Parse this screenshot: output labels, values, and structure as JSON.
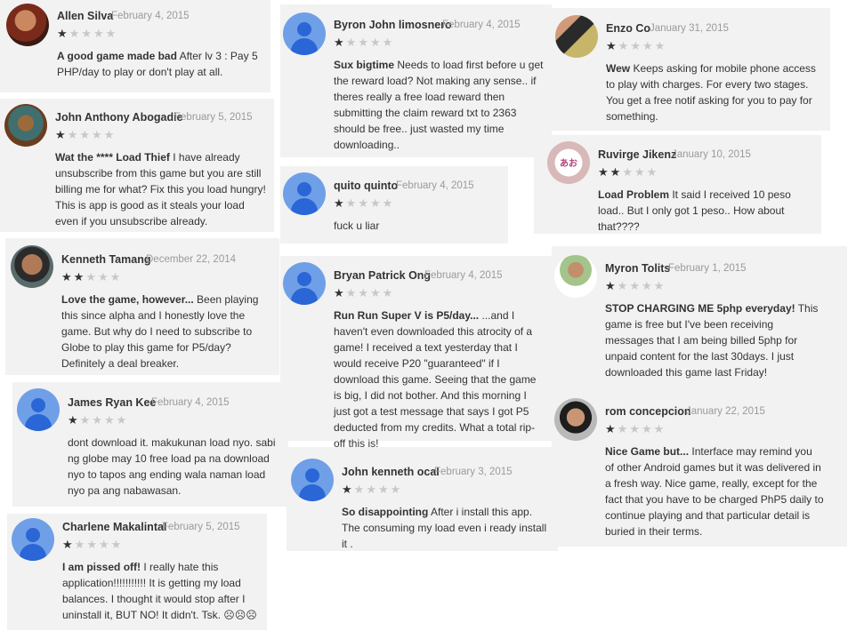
{
  "reviews": [
    {
      "name": "Allen Silva",
      "date": "February 4, 2015",
      "rating": 1,
      "title": "A good game made bad",
      "text": " After lv 3 : Pay 5 PHP/day to play or don't play at all.",
      "avatar": "photo1"
    },
    {
      "name": "John Anthony Abogadie",
      "date": "February 5, 2015",
      "rating": 1,
      "title": "Wat the **** Load Thief",
      "text": " I have already unsubscribe from this game but you are still billing me for what? Fix this you load hungry! This is app is good as it steals your load even if you unsubscribe already.",
      "avatar": "photo2"
    },
    {
      "name": "Kenneth Tamang",
      "date": "December 22, 2014",
      "rating": 2,
      "title": "Love the game, however...",
      "text": " Been playing this since alpha and I honestly love the game. But why do I need to subscribe to Globe to play this game for P5/day? Definitely a deal breaker.",
      "avatar": "photo3"
    },
    {
      "name": "James Ryan Kee",
      "date": "February 4, 2015",
      "rating": 1,
      "title": "",
      "text": "dont download it. makukunan load nyo. sabi ng globe may 10 free load pa na download nyo to tapos ang ending wala naman load nyo pa ang nabawasan.",
      "avatar": "generic"
    },
    {
      "name": "Charlene Makalintal",
      "date": "February 5, 2015",
      "rating": 1,
      "title": "I am pissed off!",
      "text": " I really hate this application!!!!!!!!!!! It is getting my load balances. I thought it would stop after I uninstall it, BUT NO! It didn't. Tsk. ☹☹☹",
      "avatar": "generic"
    },
    {
      "name": "Byron John limosnero",
      "date": "February 4, 2015",
      "rating": 1,
      "title": "Sux bigtime",
      "text": " Needs to load first before u get the reward load? Not making any sense.. if theres really a free load reward then submitting the claim reward txt to 2363 should be free.. just wasted my time downloading..",
      "avatar": "generic"
    },
    {
      "name": "quito quinto",
      "date": "February 4, 2015",
      "rating": 1,
      "title": "",
      "text": "fuck u liar",
      "avatar": "generic"
    },
    {
      "name": "Bryan Patrick Ong",
      "date": "February 4, 2015",
      "rating": 1,
      "title": "Run Run Super V is P5/day...",
      "text": " ...and I haven't even downloaded this atrocity of a game! I received a text yesterday that I would receive P20 \"guaranteed\" if I download this game. Seeing that the game is big, I did not bother. And this morning I just got a test message that says I got P5 deducted from my credits. What a total rip-off this is!",
      "avatar": "generic"
    },
    {
      "name": "John kenneth ocal",
      "date": "February 3, 2015",
      "rating": 1,
      "title": "So disappointing",
      "text": " After i install this app. The consuming my load even i ready install it .",
      "avatar": "generic"
    },
    {
      "name": "Enzo Co",
      "date": "January 31, 2015",
      "rating": 1,
      "title": "Wew",
      "text": " Keeps asking for mobile phone access to play with charges. For every two stages. You get a free notif asking for you to pay for something.",
      "avatar": "photo4"
    },
    {
      "name": "Ruvirge Jikenz",
      "date": "January 10, 2015",
      "rating": 2,
      "title": "Load Problem",
      "text": " It said I received 10 peso load.. But I only got 1 peso.. How about that????",
      "avatar": "photo5"
    },
    {
      "name": "Myron Tolits",
      "date": "February 1, 2015",
      "rating": 1,
      "title": "STOP CHARGING ME 5php everyday!",
      "text": " This game is free but I've been receiving messages that I am being billed 5php for unpaid content for the last 30days. I just downloaded this game last Friday!",
      "avatar": "photo6"
    },
    {
      "name": "rom concepcion",
      "date": "January 22, 2015",
      "rating": 1,
      "title": "Nice Game but...",
      "text": " Interface may remind you of other Android games but it was delivered in a fresh way. Nice game, really, except for the fact that you have to be charged PhP5 daily to continue playing and that particular detail is buried in their terms.",
      "avatar": "photo7"
    }
  ]
}
